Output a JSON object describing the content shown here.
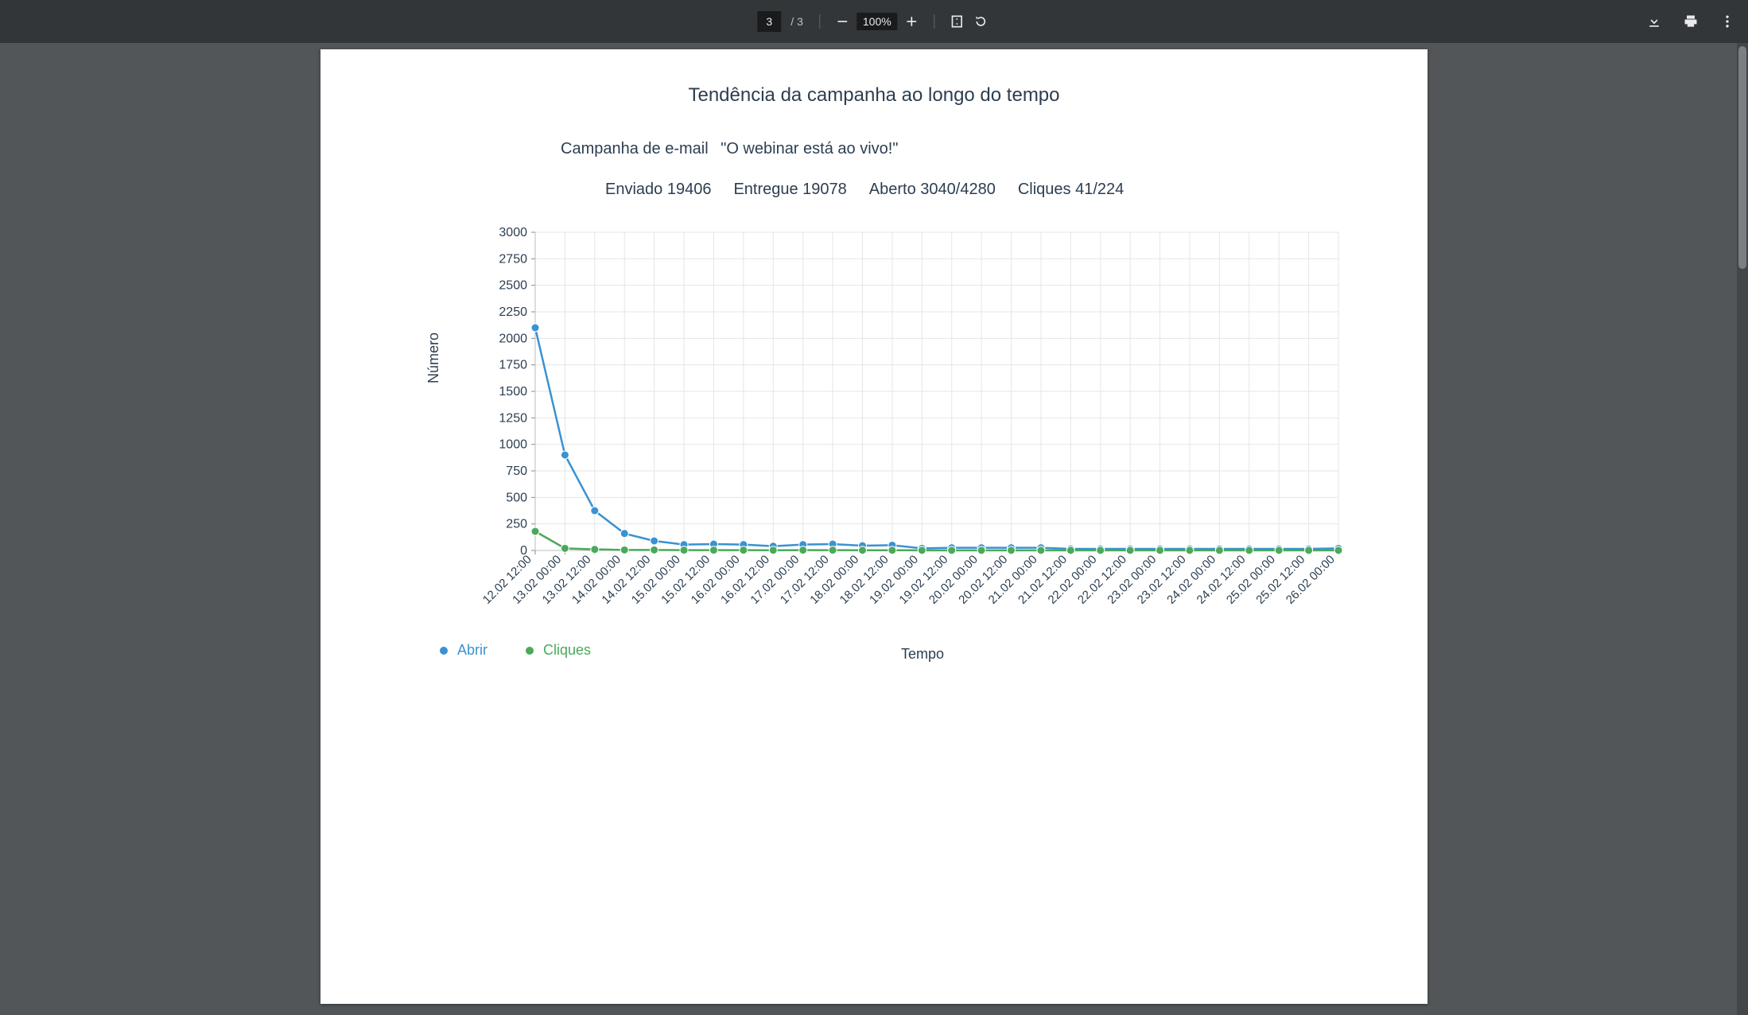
{
  "toolbar": {
    "current_page": "3",
    "total_pages": "3",
    "zoom_label": "100%"
  },
  "chart_meta": {
    "title": "Tendência da campanha ao longo do tempo",
    "campaign_label": "Campanha de e-mail",
    "campaign_name": "\"O webinar está ao vivo!\"",
    "stat_sent": "Enviado 19406",
    "stat_delivered": "Entregue 19078",
    "stat_opened": "Aberto 3040/4280",
    "stat_clicks": "Cliques 41/224",
    "ylabel": "Número",
    "xlabel": "Tempo",
    "legend_open": "Abrir",
    "legend_clicks": "Cliques"
  },
  "chart_data": {
    "type": "line",
    "title": "Tendência da campanha ao longo do tempo",
    "xlabel": "Tempo",
    "ylabel": "Número",
    "ylim": [
      0,
      3000
    ],
    "yticks": [
      0,
      250,
      500,
      750,
      1000,
      1250,
      1500,
      1750,
      2000,
      2250,
      2500,
      2750,
      3000
    ],
    "categories": [
      "12.02 12:00",
      "13.02 00:00",
      "13.02 12:00",
      "14.02 00:00",
      "14.02 12:00",
      "15.02 00:00",
      "15.02 12:00",
      "16.02 00:00",
      "16.02 12:00",
      "17.02 00:00",
      "17.02 12:00",
      "18.02 00:00",
      "18.02 12:00",
      "19.02 00:00",
      "19.02 12:00",
      "20.02 00:00",
      "20.02 12:00",
      "21.02 00:00",
      "21.02 12:00",
      "22.02 00:00",
      "22.02 12:00",
      "23.02 00:00",
      "23.02 12:00",
      "24.02 00:00",
      "24.02 12:00",
      "25.02 00:00",
      "25.02 12:00",
      "26.02 00:00"
    ],
    "series": [
      {
        "name": "Abrir",
        "color": "#3a92d2",
        "values": [
          2100,
          900,
          375,
          160,
          90,
          55,
          60,
          55,
          40,
          55,
          60,
          45,
          50,
          20,
          25,
          25,
          25,
          25,
          15,
          15,
          15,
          15,
          15,
          15,
          15,
          15,
          15,
          20
        ]
      },
      {
        "name": "Cliques",
        "color": "#4ba95a",
        "values": [
          180,
          20,
          10,
          5,
          5,
          3,
          3,
          3,
          2,
          3,
          3,
          2,
          2,
          1,
          1,
          1,
          1,
          1,
          1,
          1,
          1,
          1,
          1,
          1,
          1,
          1,
          1,
          1
        ]
      }
    ]
  }
}
